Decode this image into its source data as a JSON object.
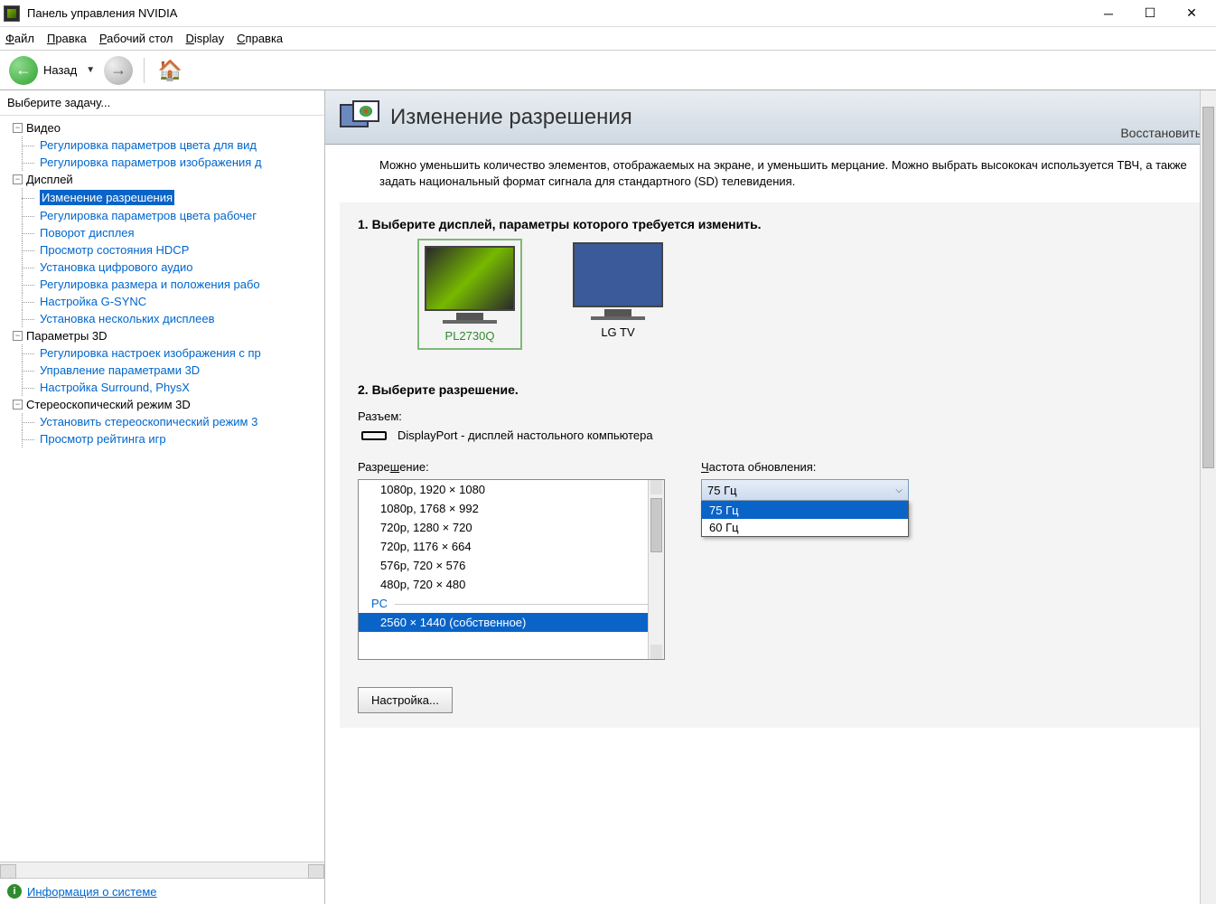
{
  "window": {
    "title": "Панель управления NVIDIA"
  },
  "menu": [
    "Файл",
    "Правка",
    "Рабочий стол",
    "Display",
    "Справка"
  ],
  "toolbar": {
    "back": "Назад"
  },
  "sidebar": {
    "header": "Выберите задачу...",
    "groups": [
      {
        "label": "Видео",
        "items": [
          "Регулировка параметров цвета для вид",
          "Регулировка параметров изображения д"
        ]
      },
      {
        "label": "Дисплей",
        "items": [
          "Изменение разрешения",
          "Регулировка параметров цвета рабочег",
          "Поворот дисплея",
          "Просмотр состояния HDCP",
          "Установка цифрового аудио",
          "Регулировка размера и положения рабо",
          "Настройка G-SYNC",
          "Установка нескольких дисплеев"
        ]
      },
      {
        "label": "Параметры 3D",
        "items": [
          "Регулировка настроек изображения с пр",
          "Управление параметрами 3D",
          "Настройка Surround, PhysX"
        ]
      },
      {
        "label": "Стереоскопический режим 3D",
        "items": [
          "Установить стереоскопический режим 3",
          "Просмотр рейтинга игр"
        ]
      }
    ],
    "selected": "Изменение разрешения",
    "footer": "Информация о системе"
  },
  "page": {
    "title": "Изменение разрешения",
    "restore": "Восстановить",
    "intro": "Можно уменьшить количество элементов, отображаемых на экране, и уменьшить мерцание. Можно выбрать высококач используется ТВЧ, а также задать национальный формат сигнала для стандартного (SD) телевидения.",
    "step1": "1. Выберите дисплей, параметры которого требуется изменить.",
    "displays": [
      {
        "name": "PL2730Q",
        "selected": true
      },
      {
        "name": "LG TV",
        "selected": false
      }
    ],
    "step2": "2. Выберите разрешение.",
    "port_label": "Разъем:",
    "port_value": "DisplayPort - дисплей настольного компьютера",
    "res_label": "Разрешение:",
    "res_items": [
      "1080p, 1920 × 1080",
      "1080p, 1768 × 992",
      "720p, 1280 × 720",
      "720p, 1176 × 664",
      "576p, 720 × 576",
      "480p, 720 × 480"
    ],
    "res_group": "PC",
    "res_selected": "2560 × 1440 (собственное)",
    "freq_label": "Частота обновления:",
    "freq_selected": "75 Гц",
    "freq_options": [
      "75 Гц",
      "60 Гц"
    ],
    "customize": "Настройка..."
  }
}
